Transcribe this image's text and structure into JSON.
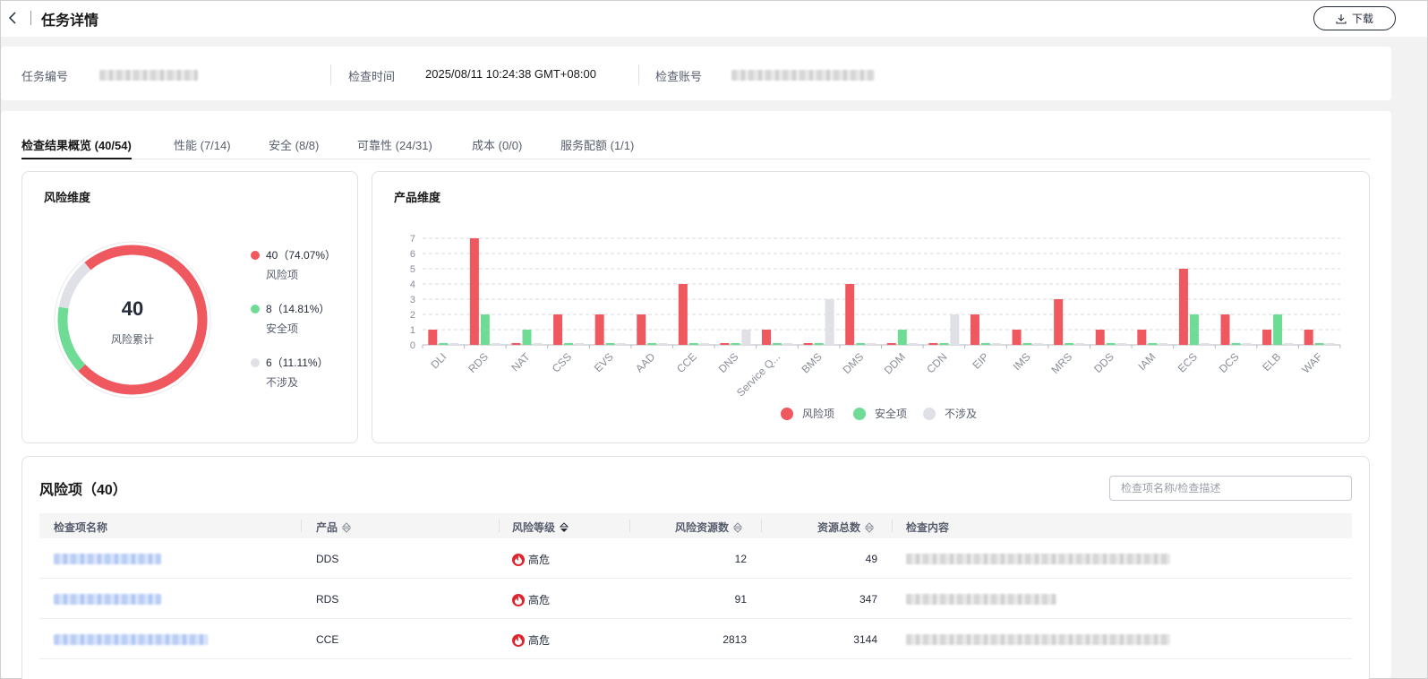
{
  "header": {
    "title": "任务详情",
    "download_label": "下载"
  },
  "info": {
    "task_no_label": "任务编号",
    "check_time_label": "检查时间",
    "check_time_value": "2025/08/11 10:24:38 GMT+08:00",
    "check_account_label": "检查账号"
  },
  "tabs": [
    {
      "label": "检查结果概览 (40/54)",
      "active": true
    },
    {
      "label": "性能 (7/14)",
      "active": false
    },
    {
      "label": "安全 (8/8)",
      "active": false
    },
    {
      "label": "可靠性 (24/31)",
      "active": false
    },
    {
      "label": "成本 (0/0)",
      "active": false
    },
    {
      "label": "服务配额 (1/1)",
      "active": false
    }
  ],
  "risk_dimension": {
    "title": "风险维度",
    "total_value": "40",
    "total_label": "风险累计",
    "legend": [
      {
        "value": "40（74.07%）",
        "label": "风险项",
        "color": "#f0585f",
        "count": 40
      },
      {
        "value": "8（14.81%）",
        "label": "安全项",
        "color": "#6fdc96",
        "count": 8
      },
      {
        "value": "6（11.11%）",
        "label": "不涉及",
        "color": "#dfe1e6",
        "count": 6
      }
    ]
  },
  "product_dimension": {
    "title": "产品维度"
  },
  "chart_data": {
    "type": "bar",
    "categories": [
      "DLI",
      "RDS",
      "NAT",
      "CSS",
      "EVS",
      "AAD",
      "CCE",
      "DNS",
      "Service Q...",
      "BMS",
      "DMS",
      "DDM",
      "CDN",
      "EIP",
      "IMS",
      "MRS",
      "DDS",
      "IAM",
      "ECS",
      "DCS",
      "ELB",
      "WAF"
    ],
    "series": [
      {
        "name": "风险项",
        "color": "#f0585f",
        "values": [
          1,
          7,
          0,
          2,
          2,
          2,
          4,
          0,
          1,
          0,
          4,
          0,
          0,
          2,
          1,
          3,
          1,
          1,
          5,
          2,
          1,
          1
        ]
      },
      {
        "name": "安全项",
        "color": "#6fdc96",
        "values": [
          0,
          2,
          1,
          0,
          0,
          0,
          0,
          0,
          0,
          0,
          0,
          1,
          0,
          0,
          0,
          0,
          0,
          0,
          2,
          0,
          2,
          0
        ]
      },
      {
        "name": "不涉及",
        "color": "#dfe1e6",
        "values": [
          0,
          0,
          0,
          0,
          0,
          0,
          0,
          1,
          0,
          3,
          0,
          0,
          2,
          0,
          0,
          0,
          0,
          0,
          0,
          0,
          0,
          0
        ]
      }
    ],
    "yticks": [
      "0",
      "1",
      "2",
      "3",
      "4",
      "5",
      "6",
      "7"
    ],
    "ylim": [
      0,
      7
    ],
    "grid": true,
    "legend_position": "bottom"
  },
  "risk_table": {
    "title": "风险项（40）",
    "search_placeholder": "检查项名称/检查描述",
    "columns": [
      "检查项名称",
      "产品",
      "风险等级",
      "风险资源数",
      "资源总数",
      "检查内容"
    ],
    "rows": [
      {
        "product": "DDS",
        "level": "高危",
        "risk_resources": "12",
        "total_resources": "49"
      },
      {
        "product": "RDS",
        "level": "高危",
        "risk_resources": "91",
        "total_resources": "347"
      },
      {
        "product": "CCE",
        "level": "高危",
        "risk_resources": "2813",
        "total_resources": "3144"
      }
    ]
  }
}
